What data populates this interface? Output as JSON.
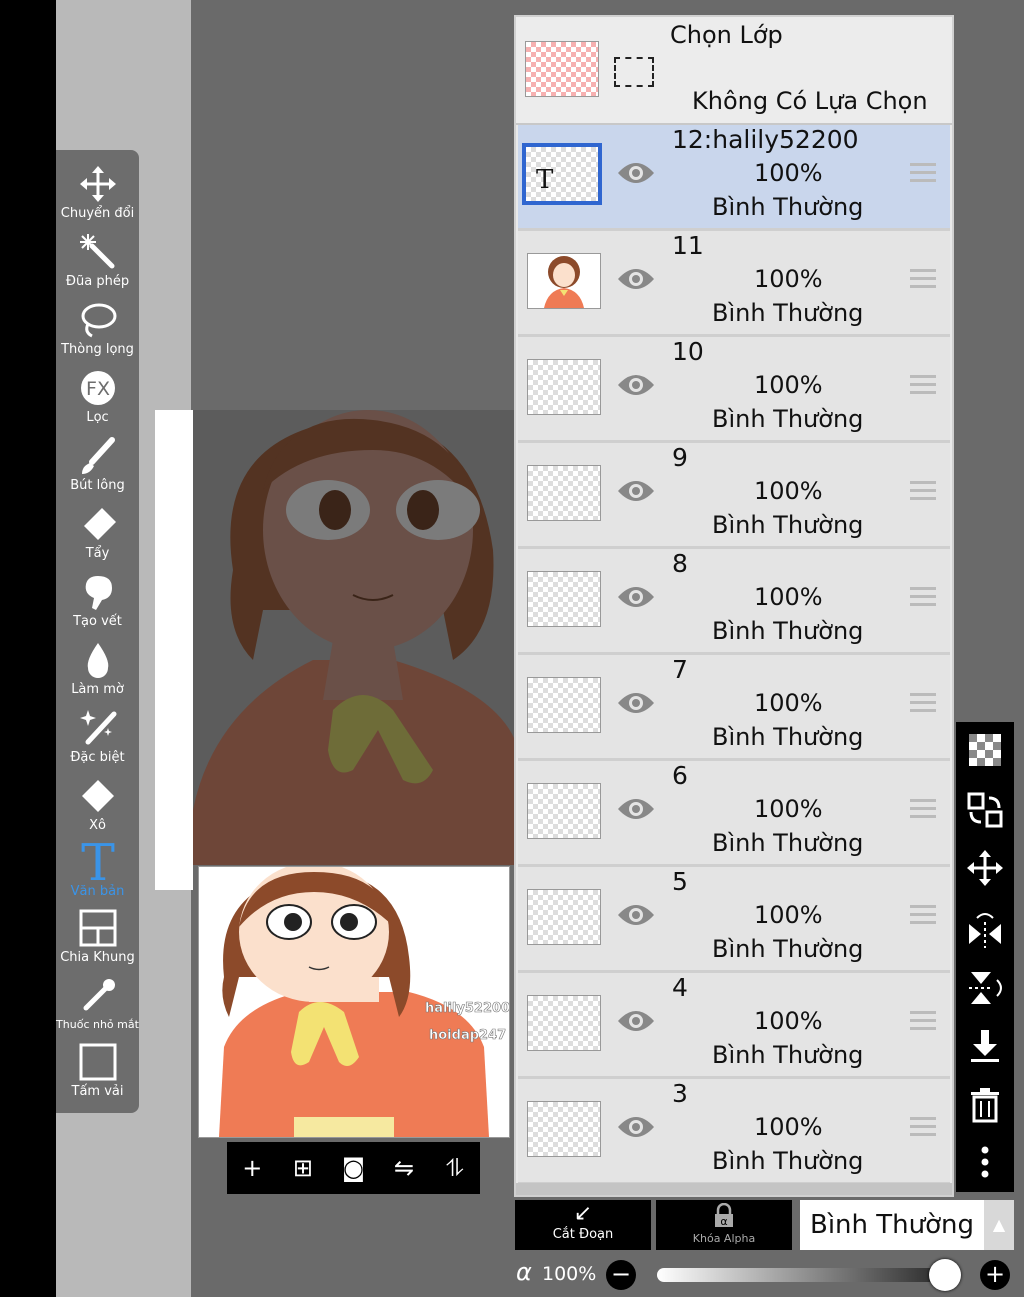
{
  "toolbar": {
    "tools": [
      {
        "label": "Chuyển đổi",
        "icon": "move-arrows-icon"
      },
      {
        "label": "Đũa phép",
        "icon": "magic-wand-icon"
      },
      {
        "label": "Thòng lọng",
        "icon": "lasso-icon"
      },
      {
        "label": "Lọc",
        "icon": "fx-icon"
      },
      {
        "label": "Bút lông",
        "icon": "brush-icon"
      },
      {
        "label": "Tẩy",
        "icon": "eraser-icon"
      },
      {
        "label": "Tạo vết",
        "icon": "smudge-icon"
      },
      {
        "label": "Làm mờ",
        "icon": "blur-drop-icon"
      },
      {
        "label": "Đặc biệt",
        "icon": "special-pen-icon"
      },
      {
        "label": "Xô",
        "icon": "bucket-icon"
      },
      {
        "label": "Văn bản",
        "icon": "text-icon"
      },
      {
        "label": "Chia Khung",
        "icon": "frame-divider-icon"
      },
      {
        "label": "Thuốc nhỏ mắt",
        "icon": "eyedropper-icon"
      },
      {
        "label": "Tấm vải",
        "icon": "canvas-icon"
      }
    ],
    "active_tool": "Văn bản"
  },
  "selection": {
    "title": "Chọn Lớp",
    "status": "Không Có Lựa Chọn"
  },
  "layers": [
    {
      "name": "12:halily52200",
      "opacity": "100%",
      "mode": "Bình Thường",
      "selected": true
    },
    {
      "name": "11",
      "opacity": "100%",
      "mode": "Bình Thường",
      "selected": false
    },
    {
      "name": "10",
      "opacity": "100%",
      "mode": "Bình Thường",
      "selected": false
    },
    {
      "name": "9",
      "opacity": "100%",
      "mode": "Bình Thường",
      "selected": false
    },
    {
      "name": "8",
      "opacity": "100%",
      "mode": "Bình Thường",
      "selected": false
    },
    {
      "name": "7",
      "opacity": "100%",
      "mode": "Bình Thường",
      "selected": false
    },
    {
      "name": "6",
      "opacity": "100%",
      "mode": "Bình Thường",
      "selected": false
    },
    {
      "name": "5",
      "opacity": "100%",
      "mode": "Bình Thường",
      "selected": false
    },
    {
      "name": "4",
      "opacity": "100%",
      "mode": "Bình Thường",
      "selected": false
    },
    {
      "name": "3",
      "opacity": "100%",
      "mode": "Bình Thường",
      "selected": false
    }
  ],
  "preview": {
    "watermark_1": "halily52200",
    "watermark_2": "hoidap247"
  },
  "bottom": {
    "clip_label": "Cắt Đoạn",
    "alpha_lock_label": "Khóa Alpha",
    "blend_mode": "Bình Thường",
    "alpha_symbol": "α",
    "opacity": "100%",
    "opacity_value": 1.0
  },
  "colors": {
    "accent": "#3a94e8",
    "selected_layer": "#c9d6ec",
    "shirt": "#ef7b55",
    "hair": "#8c4a2a",
    "scarf": "#f3e273"
  }
}
